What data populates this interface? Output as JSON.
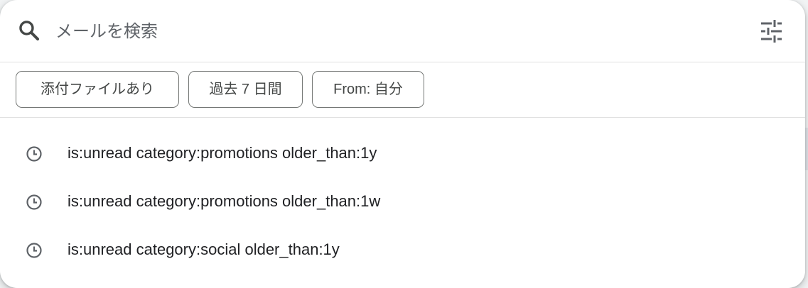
{
  "search": {
    "placeholder": "メールを検索",
    "value": ""
  },
  "icons": {
    "search": "search-icon",
    "options": "tune-icon",
    "history": "clock-icon"
  },
  "chips": [
    {
      "label": "添付ファイルあり"
    },
    {
      "label": "過去 7 日間"
    },
    {
      "label": "From: 自分"
    }
  ],
  "suggestions": [
    {
      "text": "is:unread category:promotions older_than:1y"
    },
    {
      "text": "is:unread category:promotions older_than:1w"
    },
    {
      "text": "is:unread category:social older_than:1y"
    }
  ],
  "colors": {
    "icon": "#5f6368",
    "text": "#202124",
    "chip_border": "#747775"
  }
}
